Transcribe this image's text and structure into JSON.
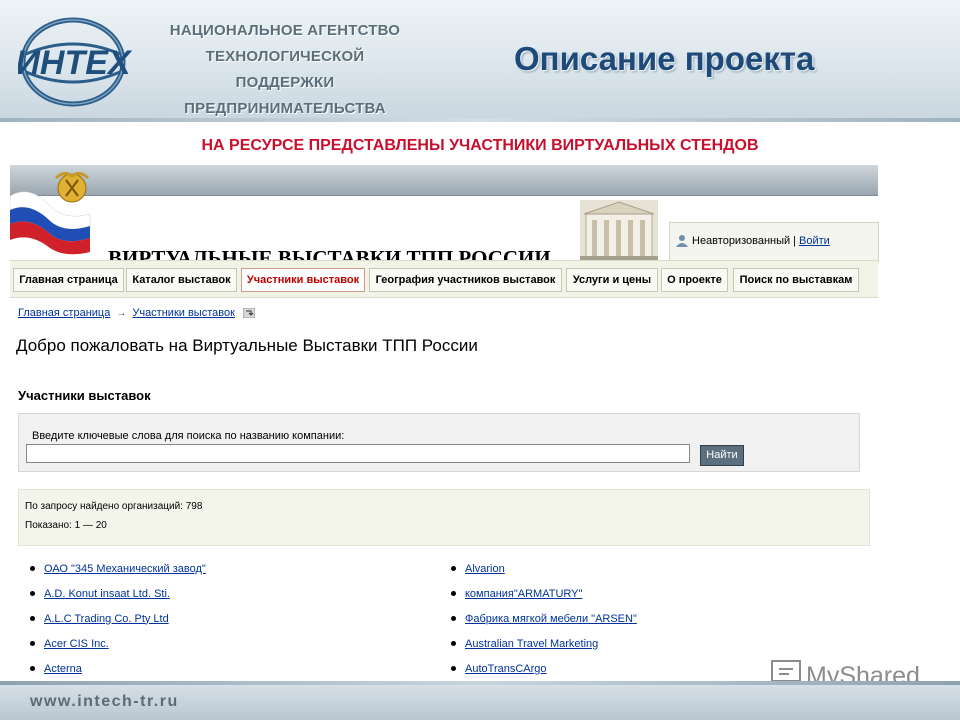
{
  "slide": {
    "logo_text": "ИНТЕХ",
    "agency_lines": [
      "НАЦИОНАЛЬНОЕ АГЕНТСТВО",
      "ТЕХНОЛОГИЧЕСКОЙ ПОДДЕРЖКИ",
      "ПРЕДПРИНИМАТЕЛЬСТВА"
    ],
    "title": "Описание проекта",
    "subtitle": "НА РЕСУРСЕ ПРЕДСТАВЛЕНЫ УЧАСТНИКИ ВИРТУАЛЬНЫХ СТЕНДОВ",
    "footer_url": "www.intech-tr.ru",
    "watermark": "MyShared"
  },
  "site": {
    "title": "ВИРТУАЛЬНЫЕ ВЫСТАВКИ ТПП РОССИИ",
    "login": {
      "status": "Неавторизованный",
      "separator": "|",
      "login_link": "Войти"
    },
    "nav": [
      {
        "label": "Главная страница",
        "active": false
      },
      {
        "label": "Каталог выставок",
        "active": false
      },
      {
        "label": "Участники выставок",
        "active": true
      },
      {
        "label": "География участников выставок",
        "active": false
      },
      {
        "label": "Услуги и цены",
        "active": false
      },
      {
        "label": "О проекте",
        "active": false
      },
      {
        "label": "Поиск по выставкам",
        "active": false
      }
    ],
    "breadcrumb": {
      "home": "Главная страница",
      "separator": "→",
      "current": "Участники выставок"
    },
    "welcome": "Добро пожаловать на Виртуальные Выставки ТПП России",
    "section_title": "Участники выставок",
    "search": {
      "label": "Введите ключевые слова для поиска по названию компании:",
      "value": "",
      "button": "Найти"
    },
    "results": {
      "found": "По запросу найдено организаций: 798",
      "shown": "Показано: 1 — 20"
    },
    "orgs_left": [
      "ОАО \"345 Механический завод\"",
      "A.D. Konut insaat Ltd. Sti.",
      "A.L.C Trading Co. Pty Ltd",
      "Acer CIS Inc.",
      "Acterna"
    ],
    "orgs_right": [
      "Alvarion",
      "компания\"ARMATURY\"",
      "Фабрика мягкой мебели \"ARSEN\"",
      "Australian Travel Marketing",
      "AutoTransCArgo"
    ]
  },
  "colors": {
    "slide_title": "#1e4a7a",
    "subtitle": "#c8102e",
    "link": "#003399",
    "active_tab": "#c00000"
  }
}
